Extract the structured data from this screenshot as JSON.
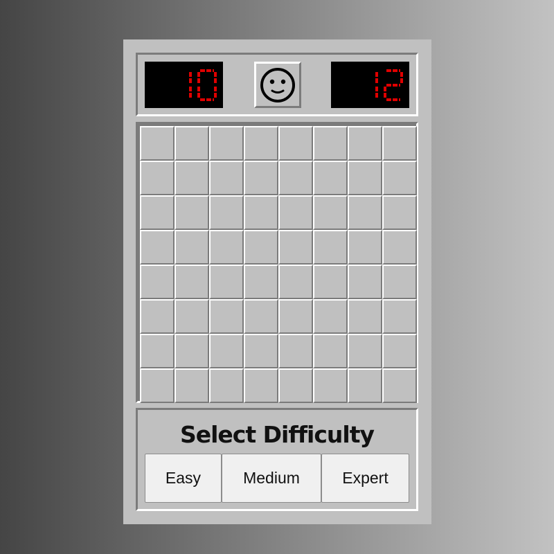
{
  "game": {
    "mine_counter": "10",
    "timer": "12",
    "face_state": "smiley-face",
    "grid": {
      "rows": 8,
      "cols": 8,
      "cell_state": "unrevealed"
    }
  },
  "difficulty": {
    "title": "Select Difficulty",
    "buttons": [
      {
        "label": "Easy"
      },
      {
        "label": "Medium"
      },
      {
        "label": "Expert"
      }
    ]
  },
  "colors": {
    "lcd_background": "#000000",
    "lcd_digits": "#e00000",
    "window": "#c0c0c0"
  }
}
